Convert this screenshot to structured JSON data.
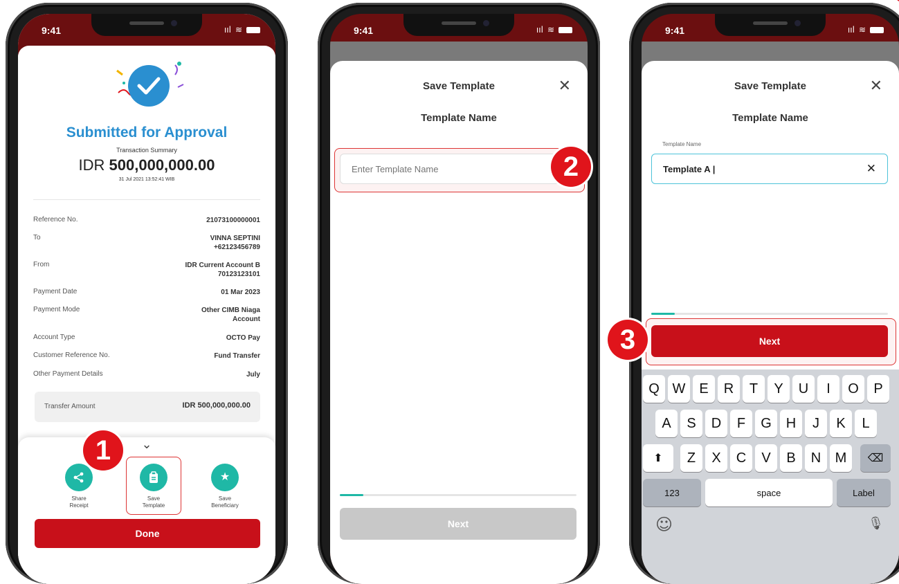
{
  "status": {
    "time": "9:41",
    "signal": "ııl",
    "wifi": "≋"
  },
  "phone1": {
    "heading": "Submitted for Approval",
    "summary_label": "Transaction Summary",
    "amount_currency": "IDR",
    "amount_value": "500,000,000.00",
    "datetime": "31 Jul 2021 13:52:41 WIB",
    "rows": [
      {
        "label": "Reference No.",
        "value": "21073100000001"
      },
      {
        "label": "To",
        "value": "VINNA SEPTINI\n+62123456789"
      },
      {
        "label": "From",
        "value": "IDR Current Account B\n70123123101"
      },
      {
        "label": "Payment Date",
        "value": "01 Mar 2023"
      },
      {
        "label": "Payment Mode",
        "value": "Other CIMB Niaga\nAccount"
      },
      {
        "label": "Account Type",
        "value": "OCTO Pay"
      },
      {
        "label": "Customer Reference No.",
        "value": "Fund Transfer"
      },
      {
        "label": "Other Payment Details",
        "value": "July"
      }
    ],
    "transfer_label": "Transfer Amount",
    "transfer_value": "IDR 500,000,000.00",
    "chevron": "⌄",
    "actions": [
      {
        "label": "Share\nReceipt",
        "icon": "share-icon"
      },
      {
        "label": "Save\nTemplate",
        "icon": "clipboard-icon"
      },
      {
        "label": "Save\nBeneficiary",
        "icon": "star-icon"
      }
    ],
    "done_label": "Done",
    "step": "1"
  },
  "phone2": {
    "title": "Save Template",
    "subtitle": "Template Name",
    "close": "✕",
    "placeholder": "Enter Template Name",
    "next_label": "Next",
    "step": "2",
    "progress": 0.1
  },
  "phone3": {
    "title": "Save Template",
    "subtitle": "Template Name",
    "close": "✕",
    "field_label": "Template Name",
    "field_value": "Template A |",
    "clear": "✕",
    "next_label": "Next",
    "step": "3",
    "progress": 0.1,
    "keyboard": {
      "row1": [
        "Q",
        "W",
        "E",
        "R",
        "T",
        "Y",
        "U",
        "I",
        "O",
        "P"
      ],
      "row2": [
        "A",
        "S",
        "D",
        "F",
        "G",
        "H",
        "J",
        "K",
        "L"
      ],
      "row3": [
        "Z",
        "X",
        "C",
        "V",
        "B",
        "N",
        "M"
      ],
      "shift": "⬆",
      "delete": "⌫",
      "numbers": "123",
      "space": "space",
      "return": "Label",
      "emoji": "☺",
      "mic": "🎙"
    }
  },
  "colors": {
    "brand_red": "#c8101a",
    "teal": "#1fb8a6",
    "blue": "#2a8fd0"
  }
}
